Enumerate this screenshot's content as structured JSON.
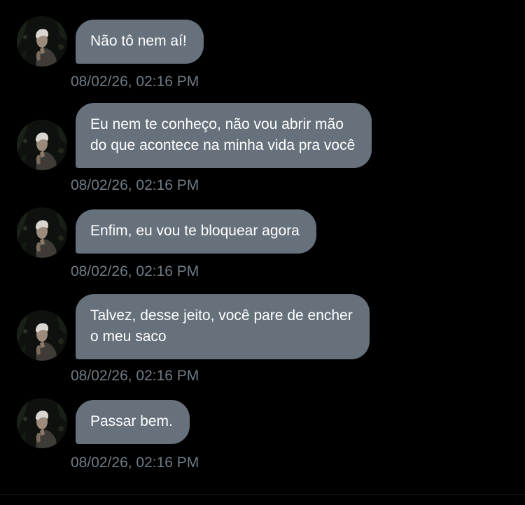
{
  "conversation": {
    "messages": [
      {
        "text": "Não tô nem aí!",
        "timestamp": "08/02/26, 02:16 PM"
      },
      {
        "text_lines": [
          "Eu nem te conheço, não vou abrir mão",
          "do que acontece na minha vida pra você"
        ],
        "timestamp": "08/02/26, 02:16 PM"
      },
      {
        "text": "Enfim, eu vou te bloquear agora",
        "timestamp": "08/02/26, 02:16 PM"
      },
      {
        "text_lines": [
          "Talvez, desse jeito, você pare de encher",
          "o meu saco"
        ],
        "timestamp": "08/02/26, 02:16 PM"
      },
      {
        "text": "Passar bem.",
        "timestamp": "08/02/26, 02:16 PM"
      }
    ]
  },
  "colors": {
    "background": "#000000",
    "bubble": "#66717c",
    "bubble_text": "#ffffff",
    "timestamp": "#6f7b85"
  }
}
